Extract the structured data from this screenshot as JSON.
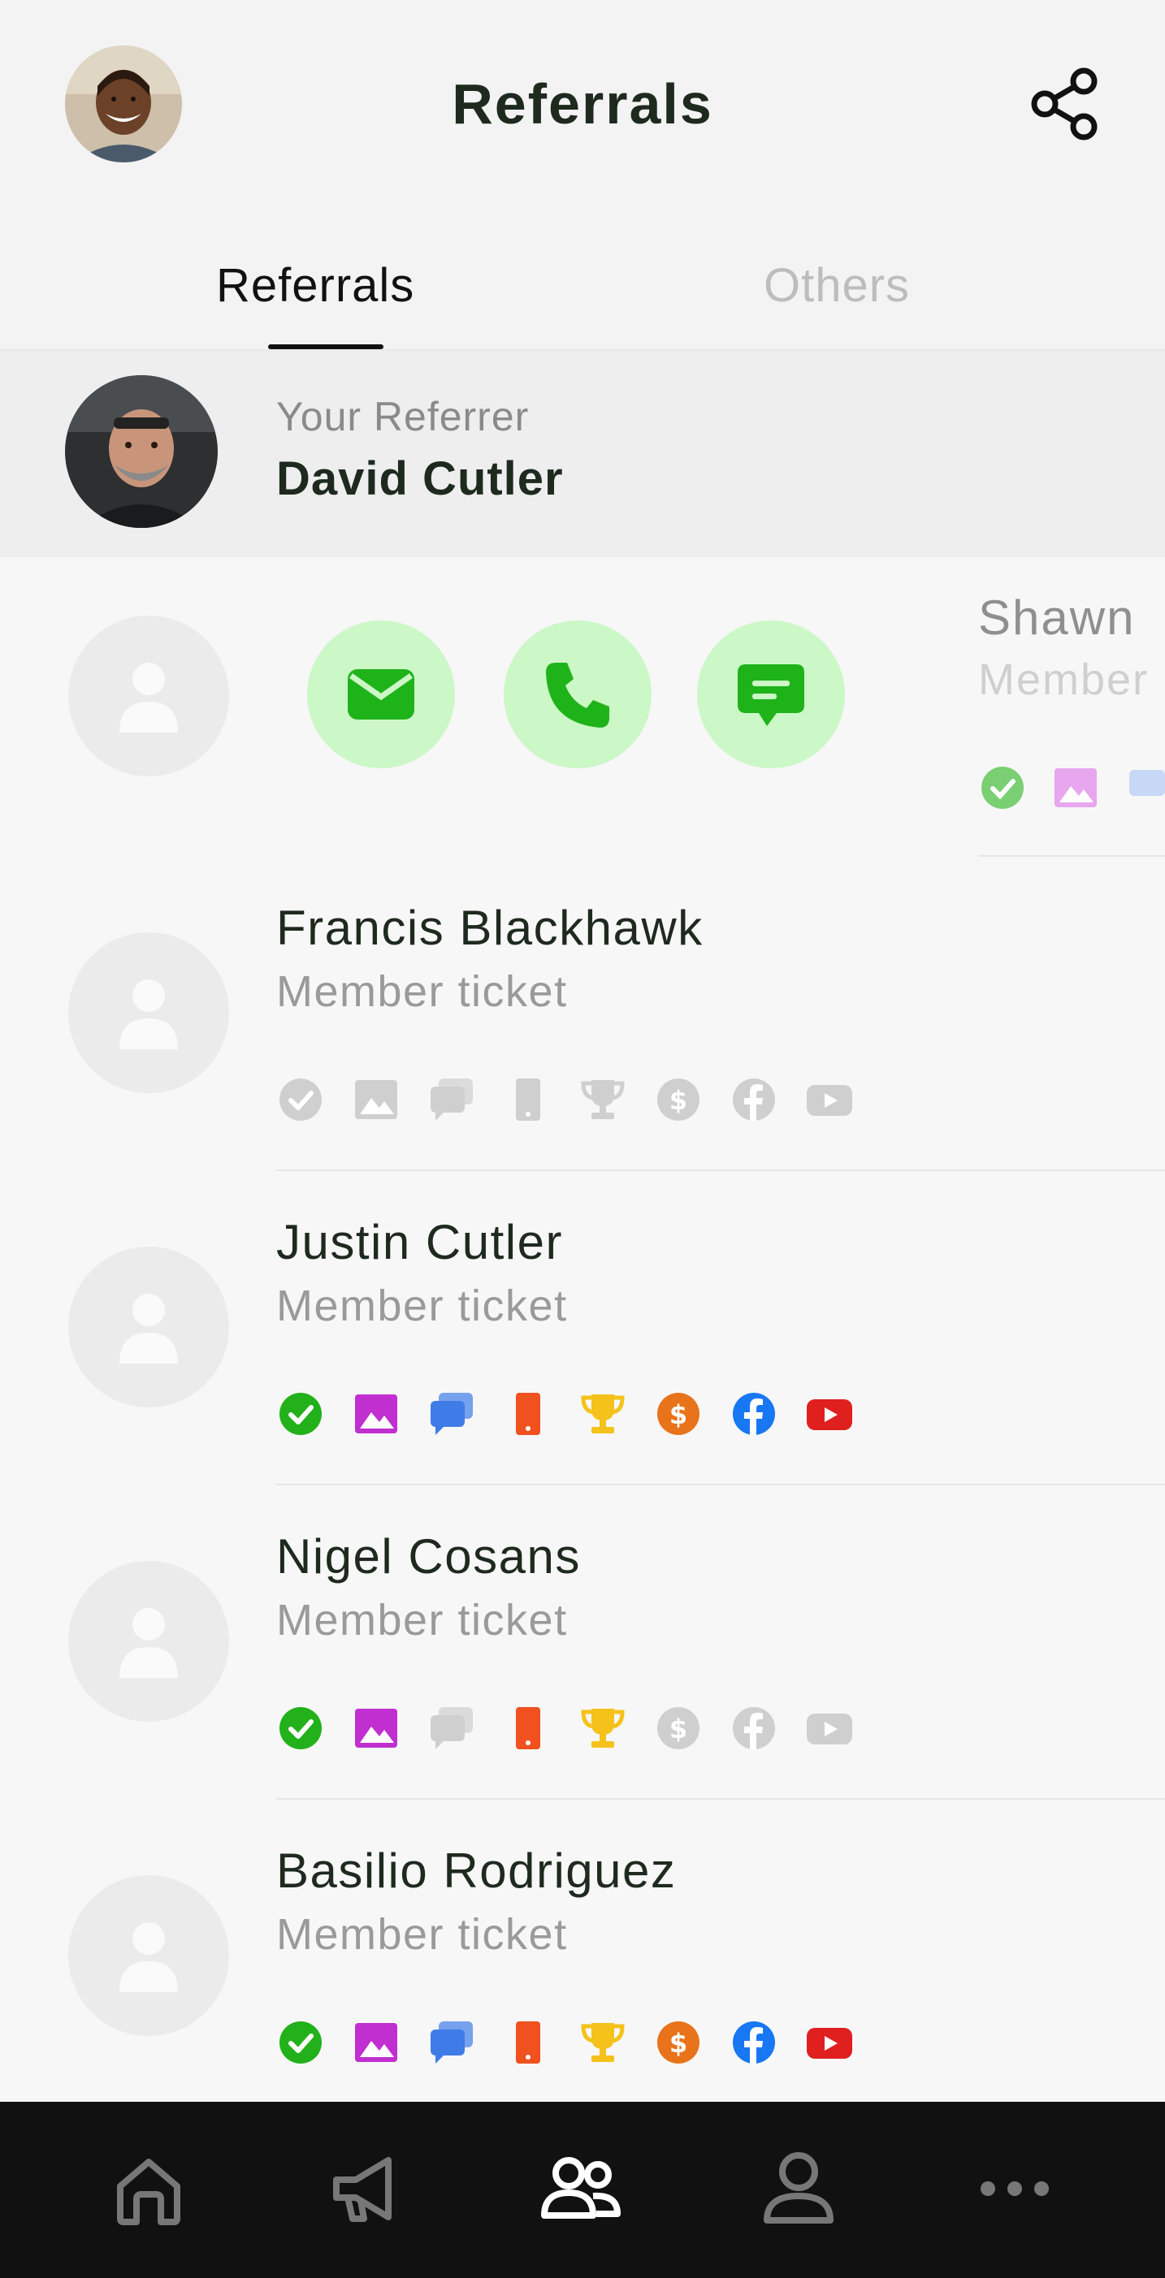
{
  "header": {
    "title": "Referrals",
    "avatar_icon": "user-avatar-photo",
    "share_icon": "share-icon"
  },
  "tabs": [
    {
      "label": "Referrals",
      "active": true
    },
    {
      "label": "Others",
      "active": false
    }
  ],
  "referrer": {
    "caption": "Your Referrer",
    "name": "David Cutler"
  },
  "expanded_row": {
    "actions": [
      {
        "icon": "email-icon"
      },
      {
        "icon": "phone-icon"
      },
      {
        "icon": "message-icon"
      }
    ],
    "peek_name": "Shawn",
    "peek_sub": "Member"
  },
  "referrals": [
    {
      "name": "Francis Blackhawk",
      "subtitle": "Member ticket",
      "badges": {
        "verified": false,
        "photo": false,
        "chat": false,
        "phone": false,
        "trophy": false,
        "dollar": false,
        "facebook": false,
        "youtube": false
      }
    },
    {
      "name": "Justin Cutler",
      "subtitle": "Member ticket",
      "badges": {
        "verified": true,
        "photo": true,
        "chat": true,
        "phone": true,
        "trophy": true,
        "dollar": true,
        "facebook": true,
        "youtube": true
      }
    },
    {
      "name": "Nigel Cosans",
      "subtitle": "Member ticket",
      "badges": {
        "verified": true,
        "photo": true,
        "chat": false,
        "phone": true,
        "trophy": true,
        "dollar": false,
        "facebook": false,
        "youtube": false
      }
    },
    {
      "name": "Basilio Rodriguez",
      "subtitle": "Member ticket",
      "badges": {
        "verified": true,
        "photo": true,
        "chat": true,
        "phone": true,
        "trophy": true,
        "dollar": true,
        "facebook": true,
        "youtube": true
      }
    }
  ],
  "colors": {
    "verified": "#22b11a",
    "photo": "#c12fd0",
    "chat": "#3f7ce8",
    "phone": "#f0511f",
    "trophy": "#f4c21a",
    "dollar": "#e8731a",
    "facebook": "#1877f2",
    "youtube": "#e0201f",
    "inactive": "#cfcfcf",
    "action_bg": "#ccf7c7",
    "action_fg": "#1fb31a"
  },
  "nav": [
    {
      "icon": "home-icon",
      "active": false
    },
    {
      "icon": "megaphone-icon",
      "active": false
    },
    {
      "icon": "people-icon",
      "active": true
    },
    {
      "icon": "person-icon",
      "active": false
    },
    {
      "icon": "more-icon",
      "active": false
    }
  ]
}
